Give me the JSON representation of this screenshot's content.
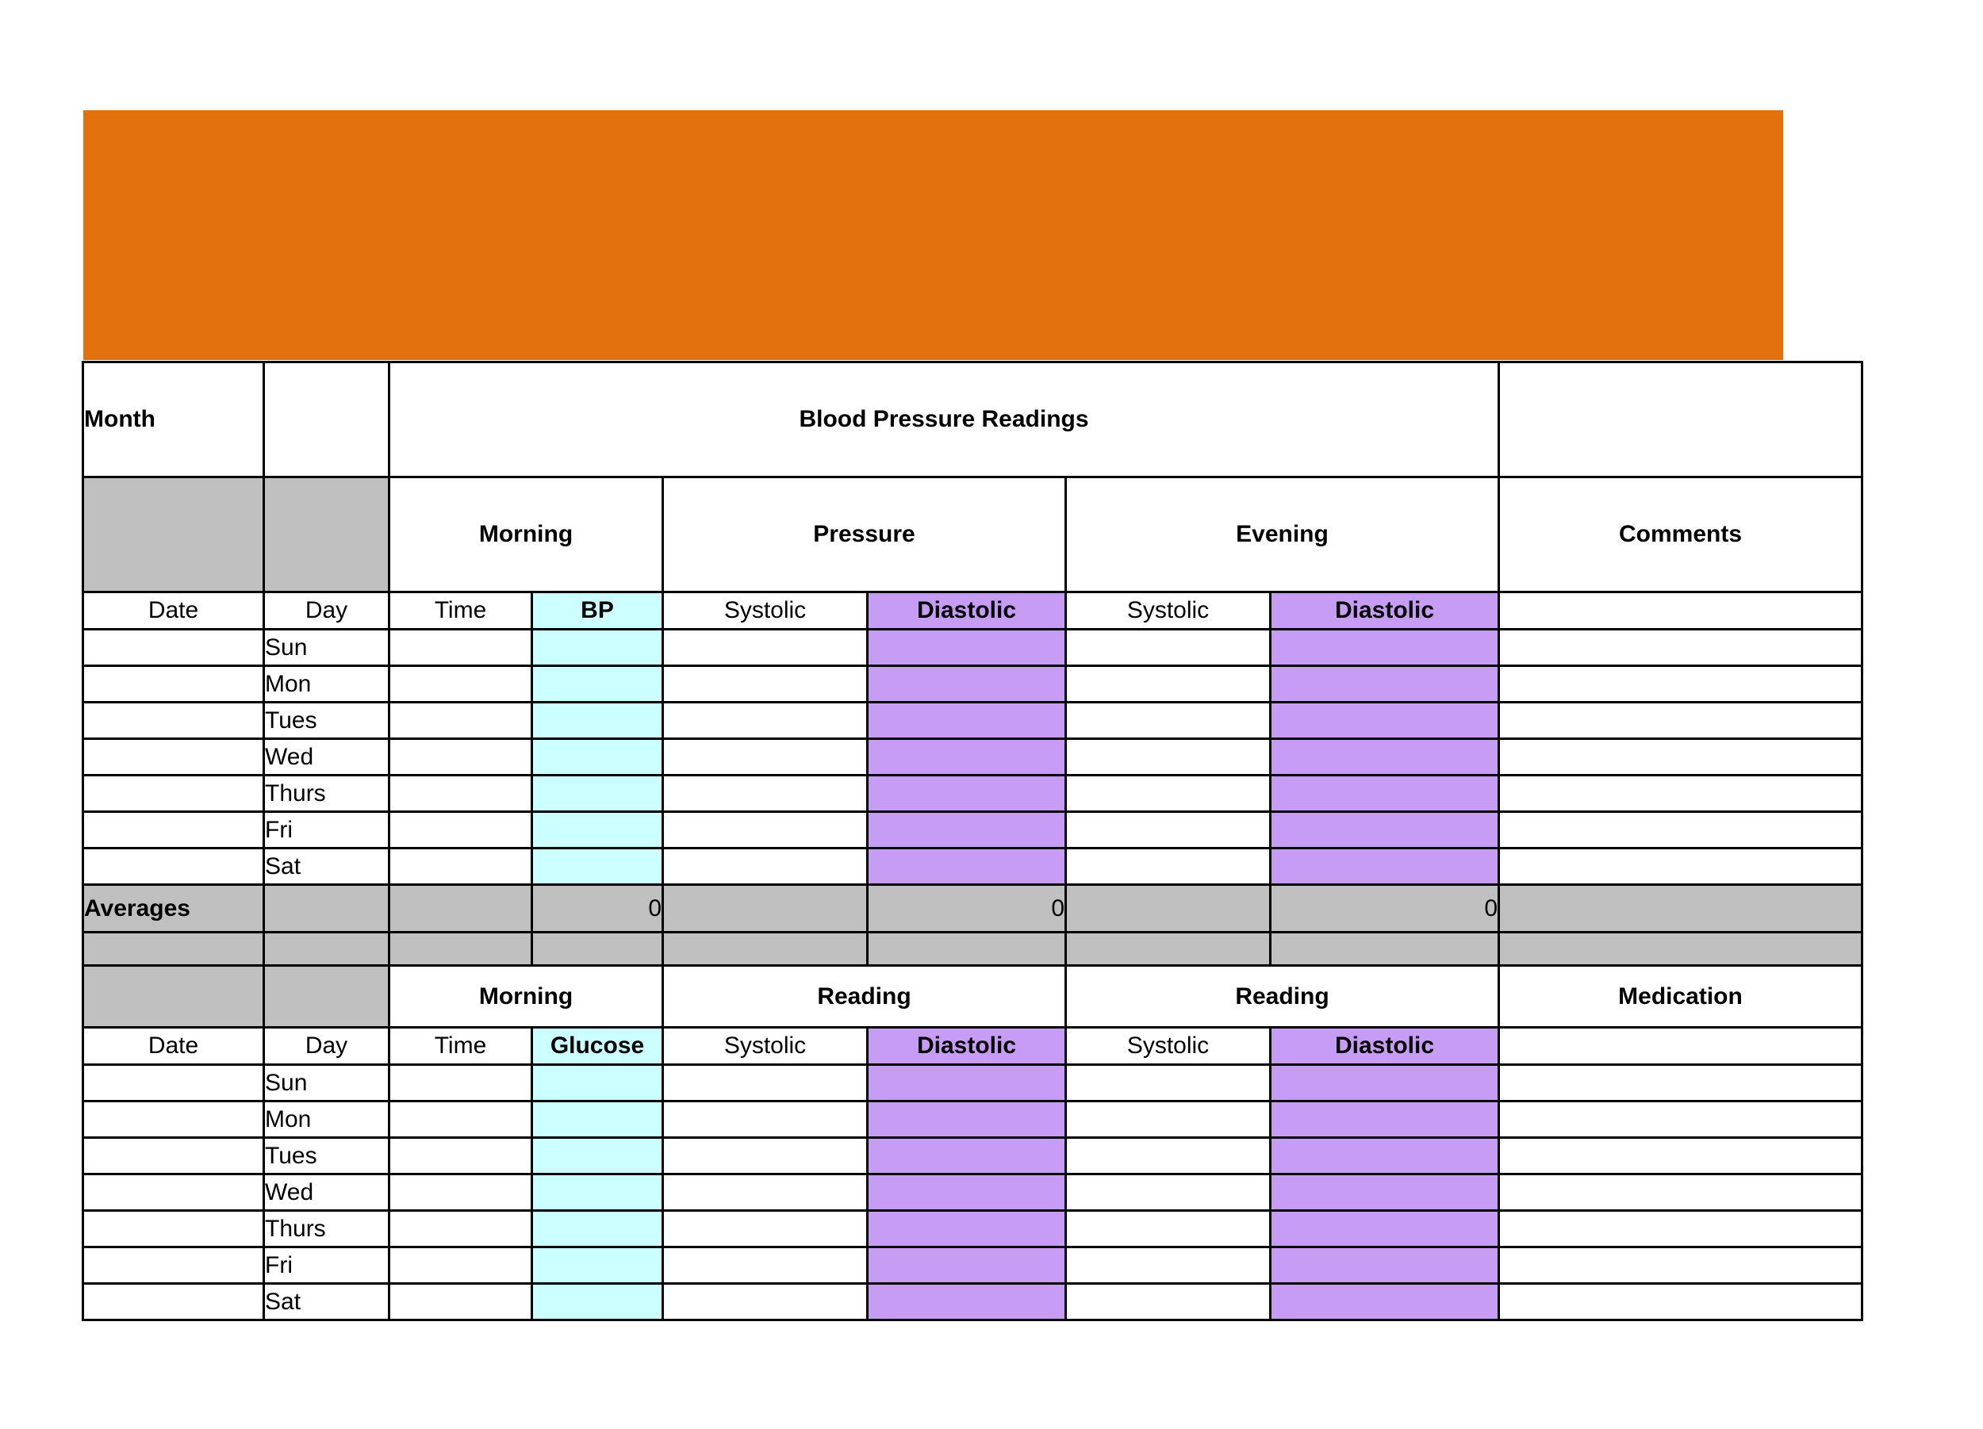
{
  "banner": {
    "color": "#E2700D",
    "label": ""
  },
  "colors": {
    "orange": "#E2700D",
    "gray": "#C0C0C0",
    "cyan": "#CCFFFF",
    "purple": "#C79CF5",
    "border": "#000000"
  },
  "title_row": {
    "month_label": "Month",
    "month_value": "",
    "title": "Blood Pressure Readings",
    "right_value": ""
  },
  "section1": {
    "groups": {
      "morning": "Morning",
      "pressure": "Pressure",
      "evening": "Evening",
      "comments": "Comments"
    },
    "columns": [
      "Date",
      "Day",
      "Time",
      "BP",
      "Systolic",
      "Diastolic",
      "Systolic",
      "Diastolic",
      ""
    ],
    "rows": [
      {
        "date": "",
        "day": "Sun",
        "time": "",
        "bp": "",
        "sys1": "",
        "dia1": "",
        "sys2": "",
        "dia2": "",
        "comments": ""
      },
      {
        "date": "",
        "day": "Mon",
        "time": "",
        "bp": "",
        "sys1": "",
        "dia1": "",
        "sys2": "",
        "dia2": "",
        "comments": ""
      },
      {
        "date": "",
        "day": "Tues",
        "time": "",
        "bp": "",
        "sys1": "",
        "dia1": "",
        "sys2": "",
        "dia2": "",
        "comments": ""
      },
      {
        "date": "",
        "day": "Wed",
        "time": "",
        "bp": "",
        "sys1": "",
        "dia1": "",
        "sys2": "",
        "dia2": "",
        "comments": ""
      },
      {
        "date": "",
        "day": "Thurs",
        "time": "",
        "bp": "",
        "sys1": "",
        "dia1": "",
        "sys2": "",
        "dia2": "",
        "comments": ""
      },
      {
        "date": "",
        "day": "Fri",
        "time": "",
        "bp": "",
        "sys1": "",
        "dia1": "",
        "sys2": "",
        "dia2": "",
        "comments": ""
      },
      {
        "date": "",
        "day": "Sat",
        "time": "",
        "bp": "",
        "sys1": "",
        "dia1": "",
        "sys2": "",
        "dia2": "",
        "comments": ""
      }
    ],
    "averages": {
      "label": "Averages",
      "date": "",
      "day": "",
      "time": "",
      "bp": "0",
      "sys1": "",
      "dia1": "0",
      "sys2": "",
      "dia2": "0",
      "comments": ""
    }
  },
  "section2": {
    "groups": {
      "morning": "Morning",
      "reading1": "Reading",
      "reading2": "Reading",
      "medication": "Medication"
    },
    "columns": [
      "Date",
      "Day",
      "Time",
      "Glucose",
      "Systolic",
      "Diastolic",
      "Systolic",
      "Diastolic",
      ""
    ],
    "rows": [
      {
        "date": "",
        "day": "Sun",
        "time": "",
        "glucose": "",
        "sys1": "",
        "dia1": "",
        "sys2": "",
        "dia2": "",
        "medication": ""
      },
      {
        "date": "",
        "day": "Mon",
        "time": "",
        "glucose": "",
        "sys1": "",
        "dia1": "",
        "sys2": "",
        "dia2": "",
        "medication": ""
      },
      {
        "date": "",
        "day": "Tues",
        "time": "",
        "glucose": "",
        "sys1": "",
        "dia1": "",
        "sys2": "",
        "dia2": "",
        "medication": ""
      },
      {
        "date": "",
        "day": "Wed",
        "time": "",
        "glucose": "",
        "sys1": "",
        "dia1": "",
        "sys2": "",
        "dia2": "",
        "medication": ""
      },
      {
        "date": "",
        "day": "Thurs",
        "time": "",
        "glucose": "",
        "sys1": "",
        "dia1": "",
        "sys2": "",
        "dia2": "",
        "medication": ""
      },
      {
        "date": "",
        "day": "Fri",
        "time": "",
        "glucose": "",
        "sys1": "",
        "dia1": "",
        "sys2": "",
        "dia2": "",
        "medication": ""
      },
      {
        "date": "",
        "day": "Sat",
        "time": "",
        "glucose": "",
        "sys1": "",
        "dia1": "",
        "sys2": "",
        "dia2": "",
        "medication": ""
      }
    ]
  }
}
